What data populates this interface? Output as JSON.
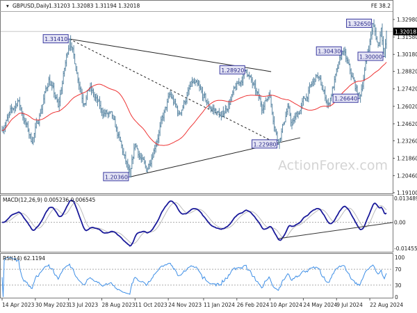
{
  "header": {
    "symbol": "GBPUSD,Daily",
    "ohlc": "1.31203 1.32083 1.31194 1.32018",
    "fib_note": "FE 38.2"
  },
  "watermark": "ActionForex.com",
  "colors": {
    "bars": "#5a86a3",
    "sma": "#ee3333",
    "macd": "#1a1a9a",
    "signal": "#bbbbbb",
    "rsi": "#3d8ee6",
    "label_border": "#3a3aa0",
    "label_fill": "#e4e4f4"
  },
  "chart_data": {
    "type": "ohlc-bar",
    "title": "GBPUSD,Daily",
    "current_price": "1.32018",
    "price_axis": {
      "ylim": [
        1.191,
        1.3298
      ],
      "ticks": [
        "1.32980",
        "1.31580",
        "1.30180",
        "1.28820",
        "1.27420",
        "1.26020",
        "1.24620",
        "1.23260",
        "1.21860",
        "1.20460",
        "1.19100"
      ]
    },
    "date_ticks": [
      {
        "label": "14 Apr 2023",
        "date": "2023-04-14"
      },
      {
        "label": "30 May 2023",
        "date": "2023-05-30"
      },
      {
        "label": "13 Jul 2023",
        "date": "2023-07-13"
      },
      {
        "label": "28 Aug 2023",
        "date": "2023-08-28"
      },
      {
        "label": "11 Oct 2023",
        "date": "2023-10-11"
      },
      {
        "label": "24 Nov 2023",
        "date": "2023-11-24"
      },
      {
        "label": "11 Jan 2024",
        "date": "2024-01-11"
      },
      {
        "label": "26 Feb 2024",
        "date": "2024-02-26"
      },
      {
        "label": "10 Apr 2024",
        "date": "2024-04-10"
      },
      {
        "label": "24 May 2024",
        "date": "2024-05-24"
      },
      {
        "label": "9 Jul 2024",
        "date": "2024-07-09"
      },
      {
        "label": "22 Aug 2024",
        "date": "2024-08-22"
      }
    ],
    "price_path": [
      [
        "2023-04-14",
        1.241
      ],
      [
        "2023-05-05",
        1.265
      ],
      [
        "2023-05-25",
        1.231
      ],
      [
        "2023-06-16",
        1.282
      ],
      [
        "2023-06-29",
        1.26
      ],
      [
        "2023-07-14",
        1.3141
      ],
      [
        "2023-08-03",
        1.262
      ],
      [
        "2023-08-10",
        1.275
      ],
      [
        "2023-08-25",
        1.258
      ],
      [
        "2023-09-12",
        1.25
      ],
      [
        "2023-10-04",
        1.2036
      ],
      [
        "2023-10-11",
        1.23
      ],
      [
        "2023-10-26",
        1.208
      ],
      [
        "2023-11-28",
        1.27
      ],
      [
        "2023-12-08",
        1.254
      ],
      [
        "2023-12-28",
        1.28
      ],
      [
        "2024-01-17",
        1.262
      ],
      [
        "2024-02-05",
        1.252
      ],
      [
        "2024-03-08",
        1.2892
      ],
      [
        "2024-04-01",
        1.258
      ],
      [
        "2024-04-09",
        1.27
      ],
      [
        "2024-04-22",
        1.2298
      ],
      [
        "2024-05-03",
        1.26
      ],
      [
        "2024-05-09",
        1.245
      ],
      [
        "2024-06-12",
        1.285
      ],
      [
        "2024-06-27",
        1.262
      ],
      [
        "2024-07-17",
        1.3043
      ],
      [
        "2024-08-08",
        1.2664
      ],
      [
        "2024-08-27",
        1.3265
      ],
      [
        "2024-09-03",
        1.309
      ],
      [
        "2024-09-06",
        1.323
      ],
      [
        "2024-09-11",
        1.3
      ],
      [
        "2024-09-13",
        1.32018
      ]
    ],
    "moving_average": {
      "type": "SMA",
      "period": 55
    },
    "pivot_labels": [
      {
        "text": "1.31410",
        "date": "2023-07-14",
        "price": 1.3141,
        "kind": "high"
      },
      {
        "text": "1.20360",
        "date": "2023-10-04",
        "price": 1.2036,
        "kind": "low"
      },
      {
        "text": "1.28920",
        "date": "2024-03-08",
        "price": 1.2892,
        "kind": "high"
      },
      {
        "text": "1.22980",
        "date": "2024-04-22",
        "price": 1.2298,
        "kind": "low"
      },
      {
        "text": "1.26640",
        "date": "2024-08-08",
        "price": 1.2664,
        "kind": "low"
      },
      {
        "text": "1.30430",
        "date": "2024-07-17",
        "price": 1.3043,
        "kind": "high"
      },
      {
        "text": "1.32650",
        "date": "2024-08-27",
        "price": 1.3265,
        "kind": "high"
      },
      {
        "text": "1.30000",
        "date": "2024-09-11",
        "price": 1.3,
        "kind": "low"
      }
    ],
    "trendlines": [
      {
        "from": [
          "2023-07-14",
          1.3141
        ],
        "to": [
          "2024-04-11",
          1.288
        ],
        "style": "solid"
      },
      {
        "from": [
          "2023-10-04",
          1.2036
        ],
        "to": [
          "2024-05-21",
          1.235
        ],
        "style": "solid"
      },
      {
        "from": [
          "2023-07-14",
          1.3141
        ],
        "to": [
          "2024-04-22",
          1.2298
        ],
        "style": "dashed"
      }
    ],
    "macd": {
      "label": "MACD(12,26,9) 0.005236 0.006545",
      "params": [
        12,
        26,
        9
      ],
      "ylim": [
        -0.014554,
        0.013489
      ],
      "ticks": [
        "0.013489",
        "0.00",
        "-0.014554"
      ],
      "trendline": {
        "from": [
          "2024-04-22",
          -0.0091
        ],
        "to": [
          "2024-09-13",
          -0.0001
        ]
      }
    },
    "rsi": {
      "label": "RSI(14) 62.1194",
      "period": 14,
      "ylim": [
        0,
        100
      ],
      "ticks": [
        "100",
        "70",
        "30",
        "0"
      ],
      "levels": [
        70,
        30
      ]
    }
  }
}
